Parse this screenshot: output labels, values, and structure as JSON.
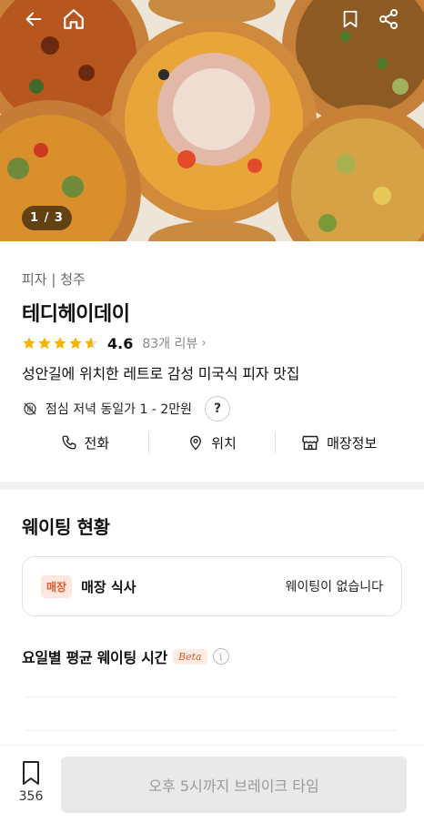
{
  "hero": {
    "counter": "1 / 3",
    "icons": [
      "back-arrow-icon",
      "home-icon",
      "bookmark-icon",
      "share-icon"
    ]
  },
  "store": {
    "category": "피자 | 청주",
    "name": "테디헤이데이",
    "rating": "4.6",
    "stars": 4.6,
    "reviews": "83개 리뷰",
    "description": "성안길에 위치한 레트로 감성 미국식 피자 맛집",
    "price": "점심 저녁 동일가 1 - 2만원",
    "help": "?"
  },
  "actions": {
    "call": "전화",
    "location": "위치",
    "store_info": "매장정보"
  },
  "waiting": {
    "title": "웨이팅 현황",
    "badge": "매장",
    "type": "매장 식사",
    "status": "웨이팅이 없습니다",
    "avg_title": "요일별 평균 웨이팅 시간",
    "beta": "Beta",
    "info": "i"
  },
  "bottom": {
    "save_count": "356",
    "cta": "오후 5시까지 브레이크 타임"
  },
  "colors": {
    "accent": "#e0582d",
    "star": "#f5b400"
  }
}
